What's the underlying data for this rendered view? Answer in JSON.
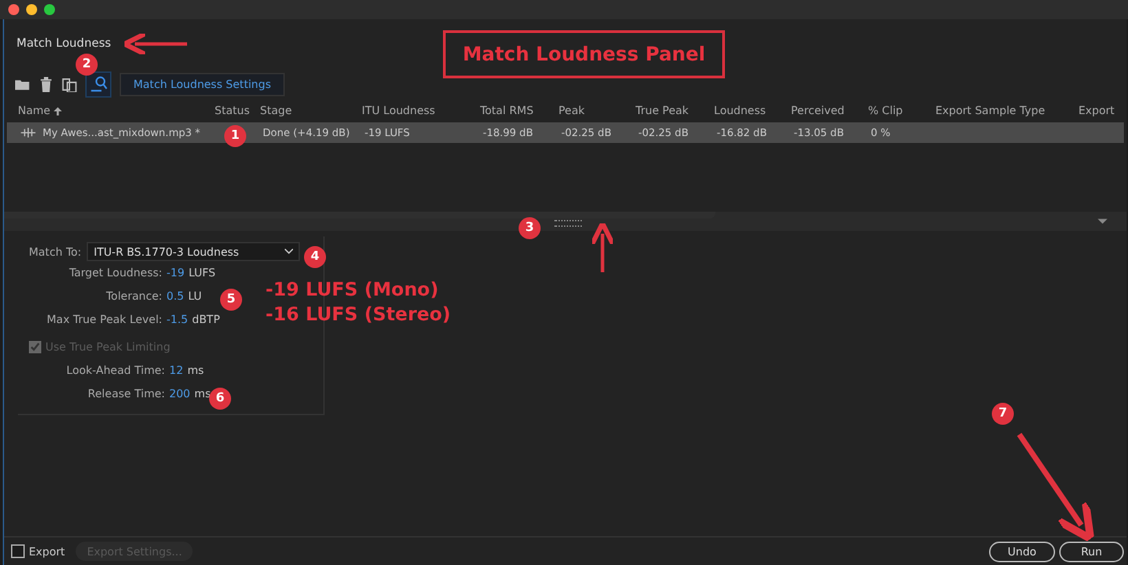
{
  "panel": {
    "title": "Match Loudness"
  },
  "toolbar": {
    "settings_tab": {
      "label": "Match Loudness Settings",
      "selected": true
    }
  },
  "table": {
    "columns": [
      {
        "label": "Name",
        "sorted": true
      },
      {
        "label": "Status",
        "sorted": false
      },
      {
        "label": "Stage",
        "sorted": false
      },
      {
        "label": "ITU Loudness",
        "sorted": false
      },
      {
        "label": "Total RMS",
        "sorted": false
      },
      {
        "label": "Peak",
        "sorted": false
      },
      {
        "label": "True Peak",
        "sorted": false
      },
      {
        "label": "Loudness",
        "sorted": false
      },
      {
        "label": "Perceived",
        "sorted": false
      },
      {
        "label": "% Clip",
        "sorted": false
      },
      {
        "label": "Export Sample Type",
        "sorted": false
      },
      {
        "label": "Export",
        "sorted": false
      }
    ],
    "rows": [
      {
        "selected": true,
        "cells": [
          "My Awes...ast_mixdown.mp3 *",
          "",
          "Done (+4.19 dB)",
          "-19 LUFS",
          "-18.99 dB",
          "-02.25 dB",
          "-02.25 dB",
          "-16.82 dB",
          "-13.05 dB",
          "0 %",
          "",
          ""
        ]
      }
    ]
  },
  "settings": {
    "match_to": {
      "label": "Match To:",
      "value": "ITU-R BS.1770-3 Loudness"
    },
    "fields": [
      {
        "label": "Target Loudness:",
        "value": "-19",
        "unit": "LUFS"
      },
      {
        "label": "Tolerance:",
        "value": "0.5",
        "unit": "LU"
      },
      {
        "label": "Max True Peak Level:",
        "value": "-1.5",
        "unit": "dBTP"
      }
    ],
    "limiting": {
      "label": "Use True Peak Limiting",
      "checked": true,
      "disabled": true
    },
    "limit_fields": [
      {
        "label": "Look-Ahead Time:",
        "value": "12",
        "unit": "ms"
      },
      {
        "label": "Release Time:",
        "value": "200",
        "unit": "ms"
      }
    ]
  },
  "footer": {
    "export": {
      "label": "Export",
      "checked": false
    },
    "export_settings": {
      "label": "Export Settings...",
      "disabled": true
    },
    "buttons": [
      "Undo",
      "Run"
    ]
  },
  "annotations": {
    "title_box": "Match Loudness Panel",
    "markers": [
      "1",
      "2",
      "3",
      "4",
      "5",
      "6",
      "7"
    ],
    "note_lines": [
      "-19 LUFS (Mono)",
      "-16 LUFS (Stereo)"
    ]
  }
}
